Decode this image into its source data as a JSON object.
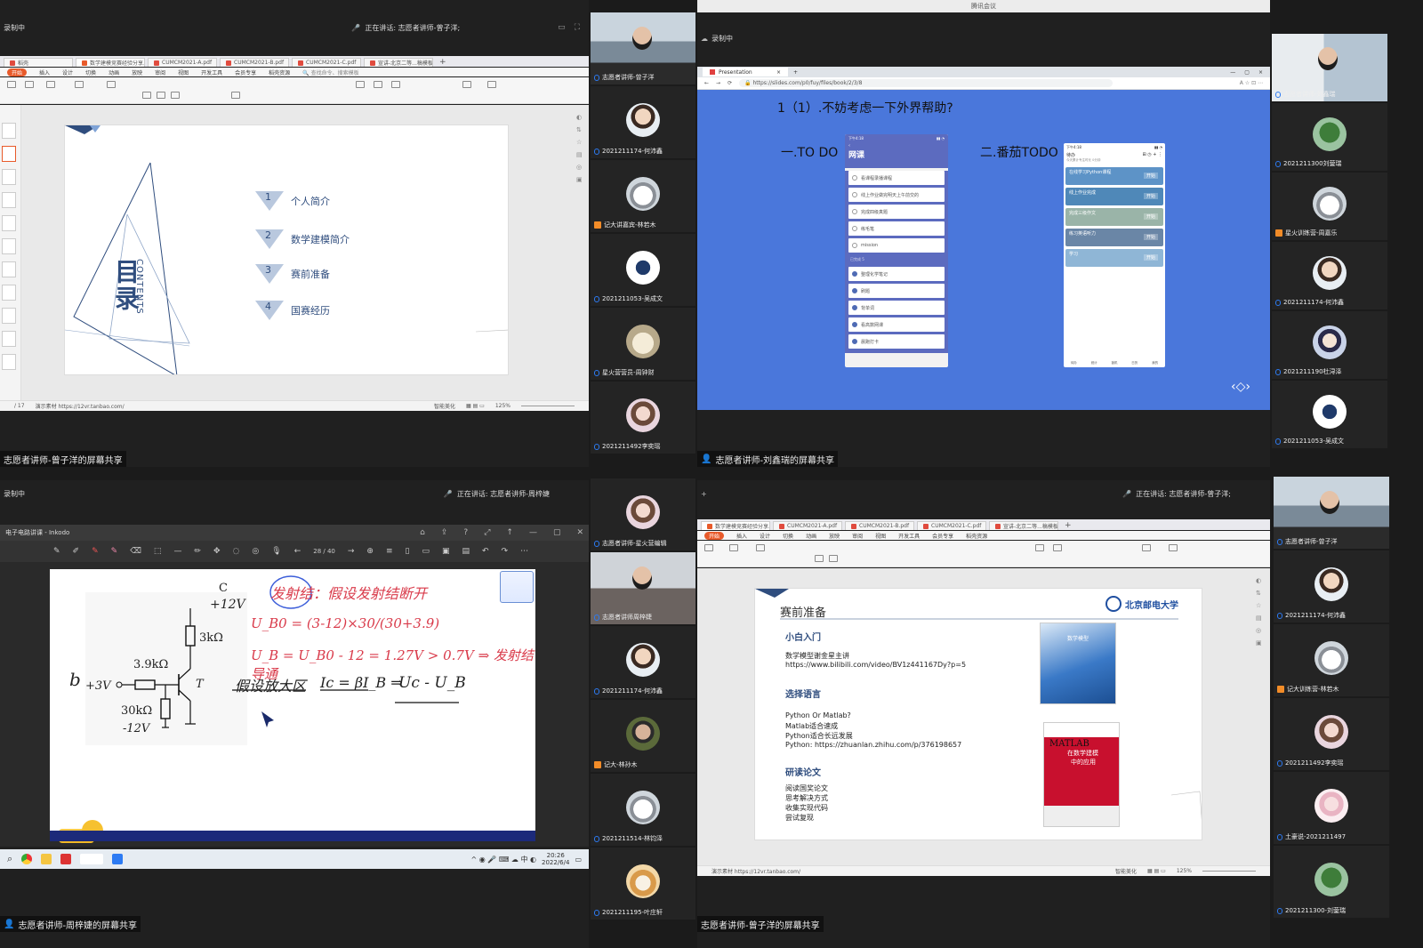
{
  "window_title": "腾讯会议",
  "q1": {
    "recording": "录制中",
    "speaking": "正在讲话: 志愿者讲师-曾子洋;",
    "tabs": [
      "稻壳",
      "数学建模竞赛经验分享.pptx",
      "CUMCM2021-A.pdf",
      "CUMCM2021-B.pdf",
      "CUMCM2021-C.pdf",
      "宣讲-北京二等...稿模板.pdf"
    ],
    "menu": [
      "开始",
      "插入",
      "设计",
      "切换",
      "动画",
      "放映",
      "审阅",
      "视图",
      "开发工具",
      "会员专享",
      "稻壳资源"
    ],
    "search": "查找命令、搜索模板",
    "slide": {
      "title_vertical": "目录",
      "contents": "CONTENTS",
      "items": [
        {
          "num": "1",
          "text": "个人简介"
        },
        {
          "num": "2",
          "text": "数学建模简介"
        },
        {
          "num": "3",
          "text": "赛前准备"
        },
        {
          "num": "4",
          "text": "国赛经历"
        }
      ]
    },
    "status_left": "/ 17",
    "status_url": "演示素材 https://12vr.tanbao.com/",
    "status_right": "智能美化",
    "zoom": "125%",
    "share_label": "志愿者讲师-曾子洋的屏幕共享"
  },
  "q2": {
    "recording": "录制中",
    "browser_tab": "Presentation",
    "url": "https://slides.com/p0/fuy/files/book/2/3/8",
    "heading": "1（1）.不妨考虑一下外界帮助?",
    "label1": "一.TO DO",
    "label2": "二.番茄TODO",
    "phone1": {
      "time": "下午4:18",
      "title": "网课",
      "items": [
        "看课程录播课程",
        "线上作业做完明天上午前交的",
        "完成四级真题",
        "练毛笔",
        "mission"
      ],
      "done_header": "已完成 5",
      "done": [
        "整理化学笔记",
        "刷题",
        "背单词",
        "看高数网课",
        "晨跑打卡"
      ]
    },
    "phone2": {
      "time": "下午4:18",
      "tab": "待办",
      "subtitle": "今天累计专注时长 0分钟",
      "items": [
        "在线学习Python课程",
        "线上作业完成",
        "完成三级作文",
        "练习英语听力",
        "学习"
      ],
      "start": "开始",
      "bottom": [
        "待办",
        "统计",
        "锁机",
        "日历",
        "我的"
      ]
    },
    "share_label": "志愿者讲师-刘鑫瑞的屏幕共享"
  },
  "q3": {
    "recording": "录制中",
    "speaking": "正在讲话: 志愿者讲师-周梓婕",
    "app_title": "电子电路讲课 - Inkodo",
    "page": "28 / 40",
    "circuit": {
      "c": "C",
      "vcc": "+12V",
      "rc": "3kΩ",
      "rb": "3.9kΩ",
      "b": "b",
      "vb": "+3V",
      "t": "T",
      "re": "30kΩ",
      "vee": "-12V"
    },
    "notes": {
      "l1a": "发射结",
      "l1b": "：假设发射结断开",
      "l2": "U_B0 = (3-12)×30/(30+3.9)",
      "l3": "U_B = U_B0 - 12 = 1.27V > 0.7V ⇒ 发射结导通",
      "l4a": "假设放大区",
      "l4b": "Ic = βI_B ⇒",
      "l4c": "Uc - U_B"
    },
    "clock": "20:26",
    "date": "2022/6/4",
    "share_label": "志愿者讲师-周梓婕的屏幕共享"
  },
  "q4": {
    "speaking": "正在讲话: 志愿者讲师-曾子洋;",
    "tabs": [
      "数学建模竞赛经验分享.pptx",
      "CUMCM2021-A.pdf",
      "CUMCM2021-B.pdf",
      "CUMCM2021-C.pdf",
      "宣讲-北京二等...稿模板.pdf"
    ],
    "slide": {
      "title": "赛前准备",
      "univ": "北京邮电大学",
      "s1": "小白入门",
      "s1_lines": [
        "数学模型谢金星主讲",
        "https://www.bilibili.com/video/BV1z441167Dy?p=5"
      ],
      "s2": "选择语言",
      "s2_lines": [
        "Python Or Matlab?",
        "Matlab适合速成",
        "Python适合长远发展",
        "Python:   https://zhuanlan.zhihu.com/p/376198657"
      ],
      "s3": "研读论文",
      "s3_lines": [
        "阅读国奖论文",
        "思考解决方式",
        "收集实现代码",
        "尝试复现"
      ],
      "book1": "数学模型",
      "book2_a": "MATLAB",
      "book2_b": "在数学建模",
      "book2_c": "中的应用"
    },
    "status_url": "演示素材 https://12vr.tanbao.com/",
    "zoom": "125%",
    "share_label": "志愿者讲师-曾子洋的屏幕共享"
  },
  "col_a": [
    {
      "name": "志愿者讲师-曾子洋",
      "type": "video",
      "host": false
    },
    {
      "name": "2021211174-何沛鑫",
      "type": "avatar",
      "av": "boy"
    },
    {
      "name": "记大讲嘉宾-林若木",
      "type": "avatar",
      "av": "cat",
      "host": true
    },
    {
      "name": "2021211053-吴成文",
      "type": "avatar",
      "av": "bird"
    },
    {
      "name": "星火营营员-周钟财",
      "type": "avatar",
      "av": "bear"
    },
    {
      "name": "2021211492李奕瑶",
      "type": "avatar",
      "av": "girl"
    }
  ],
  "col_b": [
    {
      "name": "志愿者讲师-刘鑫瑞",
      "type": "video2"
    },
    {
      "name": "2021211300刘蓥瑞",
      "type": "avatar",
      "av": "tree"
    },
    {
      "name": "星火训练营-周嘉乐",
      "type": "avatar",
      "av": "cat",
      "host": true
    },
    {
      "name": "2021211174-何沛鑫",
      "type": "avatar",
      "av": "boy"
    },
    {
      "name": "2021211190杜浔泽",
      "type": "avatar",
      "av": "anime"
    },
    {
      "name": "2021211053-吴成文",
      "type": "avatar",
      "av": "bird"
    }
  ],
  "col_c": [
    {
      "name": "志愿者讲师-星火营编辑",
      "type": "avatar",
      "av": "girl"
    },
    {
      "name": "志愿者讲师周梓婕",
      "type": "video3"
    },
    {
      "name": "2021211174-何沛鑫",
      "type": "avatar",
      "av": "boy"
    },
    {
      "name": "记大-林孙木",
      "type": "avatar",
      "av": "man",
      "host": true
    },
    {
      "name": "2021211514-林钧泽",
      "type": "avatar",
      "av": "cat"
    },
    {
      "name": "2021211195-叶庄轩",
      "type": "avatar",
      "av": "shiba"
    }
  ],
  "col_d": [
    {
      "name": "志愿者讲师-曾子洋",
      "type": "video"
    },
    {
      "name": "2021211174-何沛鑫",
      "type": "avatar",
      "av": "boy"
    },
    {
      "name": "记大训练营-林若木",
      "type": "avatar",
      "av": "cat",
      "host": true
    },
    {
      "name": "2021211492李奕瑶",
      "type": "avatar",
      "av": "girl"
    },
    {
      "name": "土豪说-2021211497",
      "type": "avatar",
      "av": "anime2"
    },
    {
      "name": "2021211300-刘蓥瑞",
      "type": "avatar",
      "av": "tree"
    }
  ],
  "colors": {
    "accent": "#2d7bf3",
    "wps_orange": "#e85a2a",
    "slide_blue": "#2f4d7e",
    "presentation_blue": "#4a77db",
    "ink_red": "#d93a4a"
  }
}
